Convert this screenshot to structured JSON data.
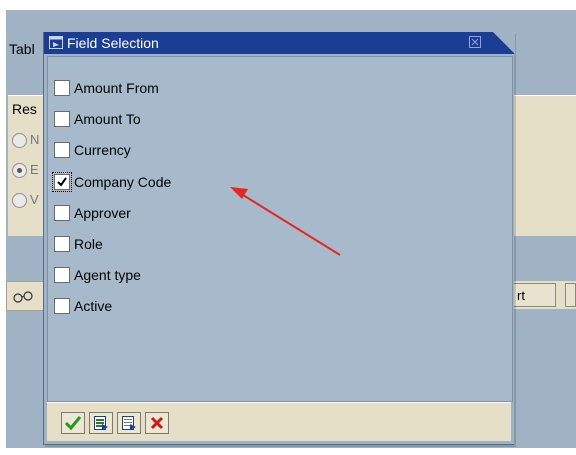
{
  "background": {
    "tab_label": "Tabl",
    "results_label": "Res",
    "radio_options": [
      {
        "text": "N",
        "selected": false
      },
      {
        "text": "E",
        "selected": true
      },
      {
        "text": "V",
        "selected": false
      }
    ],
    "button_partial": "rt"
  },
  "dialog": {
    "title": "Field Selection",
    "fields": [
      {
        "label": "Amount From",
        "checked": false
      },
      {
        "label": "Amount To",
        "checked": false
      },
      {
        "label": "Currency",
        "checked": false
      },
      {
        "label": "Company Code",
        "checked": true
      },
      {
        "label": "Approver",
        "checked": false
      },
      {
        "label": "Role",
        "checked": false
      },
      {
        "label": "Agent type",
        "checked": false
      },
      {
        "label": "Active",
        "checked": false
      }
    ],
    "footer_buttons": [
      {
        "name": "confirm",
        "icon": "green-check-icon"
      },
      {
        "name": "select-all",
        "icon": "select-all-icon"
      },
      {
        "name": "deselect-all",
        "icon": "deselect-all-icon"
      },
      {
        "name": "cancel",
        "icon": "red-x-icon"
      }
    ]
  },
  "colors": {
    "title_bar": "#1c3d94",
    "dialog_bg": "#a6bacb",
    "footer_bg": "#e5dfc8",
    "annotation_arrow": "#e8261e"
  }
}
